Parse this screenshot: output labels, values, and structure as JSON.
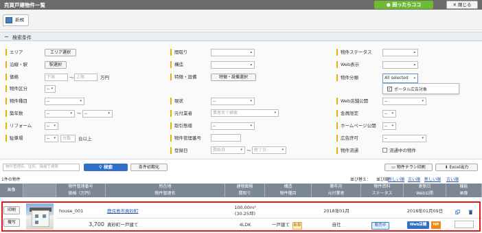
{
  "app": {
    "title": "売買戸建物件一覧",
    "help": "困ったらココ",
    "close": "閉じる"
  },
  "toolbar": {
    "new_label": "新規"
  },
  "search_section": {
    "title": "検索条件",
    "toggle": "−"
  },
  "form": {
    "area": {
      "label": "エリア",
      "btn": "エリア選択"
    },
    "line": {
      "label": "沿線・駅",
      "btn": "駅選択"
    },
    "price": {
      "label": "価格",
      "from_ph": "下限",
      "sep": "〜",
      "to_ph": "上限",
      "unit": "万円"
    },
    "prop_kubun": {
      "label": "物件区分",
      "value": "--"
    },
    "prop_type": {
      "label": "物件種目",
      "value": "--"
    },
    "age": {
      "label": "築年数",
      "from": "--",
      "sep": "〜",
      "to": "--"
    },
    "reform": {
      "label": "リフォーム",
      "value": "--"
    },
    "parking": {
      "label": "駐車場",
      "value": "--",
      "count_ph": "台数",
      "unit": "台以上"
    },
    "madori": {
      "label": "間取り"
    },
    "kozo": {
      "label": "構造"
    },
    "tokucho": {
      "label": "特徴・設備",
      "btn": "特徴・設備選択"
    },
    "genkyo": {
      "label": "現状",
      "value": "--"
    },
    "motozuke": {
      "label": "元付業者",
      "ph": "業者名で検索"
    },
    "torihiki": {
      "label": "取引態様",
      "value": "--"
    },
    "kanri": {
      "label": "物件管理番号"
    },
    "toroku": {
      "label": "登録日",
      "from_ph": "開始日",
      "sep": "〜",
      "to_ph": "終了日"
    },
    "status": {
      "label": "物件ステータス"
    },
    "web": {
      "label": "Web表示"
    },
    "bunrui": {
      "label": "物件分類",
      "value": "All selected",
      "option": "ポータル広告対象"
    },
    "web_tenpo": {
      "label": "Web店舗公開",
      "value": "--"
    },
    "kaiin": {
      "label": "会員限定",
      "value": "--"
    },
    "hp": {
      "label": "ホームページ公開",
      "value": "--"
    },
    "kokoku": {
      "label": "広告許可",
      "value": "--"
    },
    "ryutsu": {
      "label": "物件流通",
      "check": "流通中の物件"
    }
  },
  "search": {
    "placeholder": "物件管理名、住所、価格で検索",
    "btn": "検索",
    "reset": "条件初期化",
    "flyer": "物件チラシ印刷",
    "excel": "Excel出力"
  },
  "sort": {
    "count": "1件の物件",
    "label": "並び替え：",
    "options": [
      "並び順",
      "新しい順",
      "古い順",
      "新しい順",
      "古い順"
    ]
  },
  "table": {
    "headers_top": [
      "画像",
      "物件管理番号",
      "所在地",
      "建物面積",
      "構造",
      "築年月",
      "物件資料",
      "更新日",
      "機能"
    ],
    "headers_bottom": [
      "価格（万円）",
      "物件管理名",
      "間取り",
      "物件種目",
      "元付業者",
      "ステータス",
      "Web公開",
      "画像"
    ],
    "row": {
      "print": "印刷",
      "copy": "複写",
      "kanri_no": "house_001",
      "address": "鹿児島市真砂町",
      "area": "100.00m²",
      "area_tsubo": "(30.25坪)",
      "built": "2018年01月",
      "updated": "2018年01月09日",
      "price": "3,700",
      "name": "真砂町一戸建て",
      "madori": "4LDK",
      "type": "一戸建て",
      "type_tag": "新築",
      "agent": "自社",
      "status": "販売中",
      "web": "Web店舗",
      "hp": "HP"
    }
  }
}
